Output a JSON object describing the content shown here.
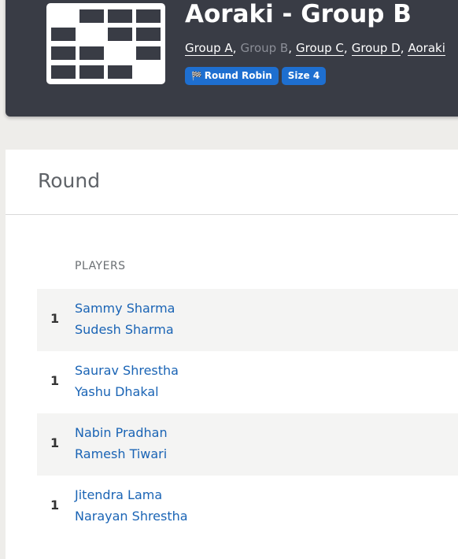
{
  "header": {
    "title": "Aoraki - Group B",
    "groups": [
      {
        "label": "Group A",
        "current": false
      },
      {
        "label": "Group B",
        "current": true
      },
      {
        "label": "Group C",
        "current": false
      },
      {
        "label": "Group D",
        "current": false
      },
      {
        "label": "Aoraki",
        "current": false
      }
    ],
    "badges": {
      "format": {
        "icon": "checkered-flag-icon",
        "glyph": "🏁",
        "label": "Round Robin"
      },
      "size": {
        "label": "Size 4"
      }
    }
  },
  "card": {
    "title": "Round",
    "column_header": "PLAYERS",
    "rows": [
      {
        "number": "1",
        "players": [
          "Sammy Sharma",
          "Sudesh Sharma"
        ]
      },
      {
        "number": "1",
        "players": [
          "Saurav Shrestha",
          "Yashu Dhakal"
        ]
      },
      {
        "number": "1",
        "players": [
          "Nabin Pradhan",
          "Ramesh Tiwari"
        ]
      },
      {
        "number": "1",
        "players": [
          "Jitendra Lama",
          "Narayan Shrestha"
        ]
      }
    ]
  },
  "colors": {
    "header_bg": "#393c45",
    "accent": "#1e6fd0",
    "link": "#1a64b5",
    "page_bg": "#eeedea"
  }
}
